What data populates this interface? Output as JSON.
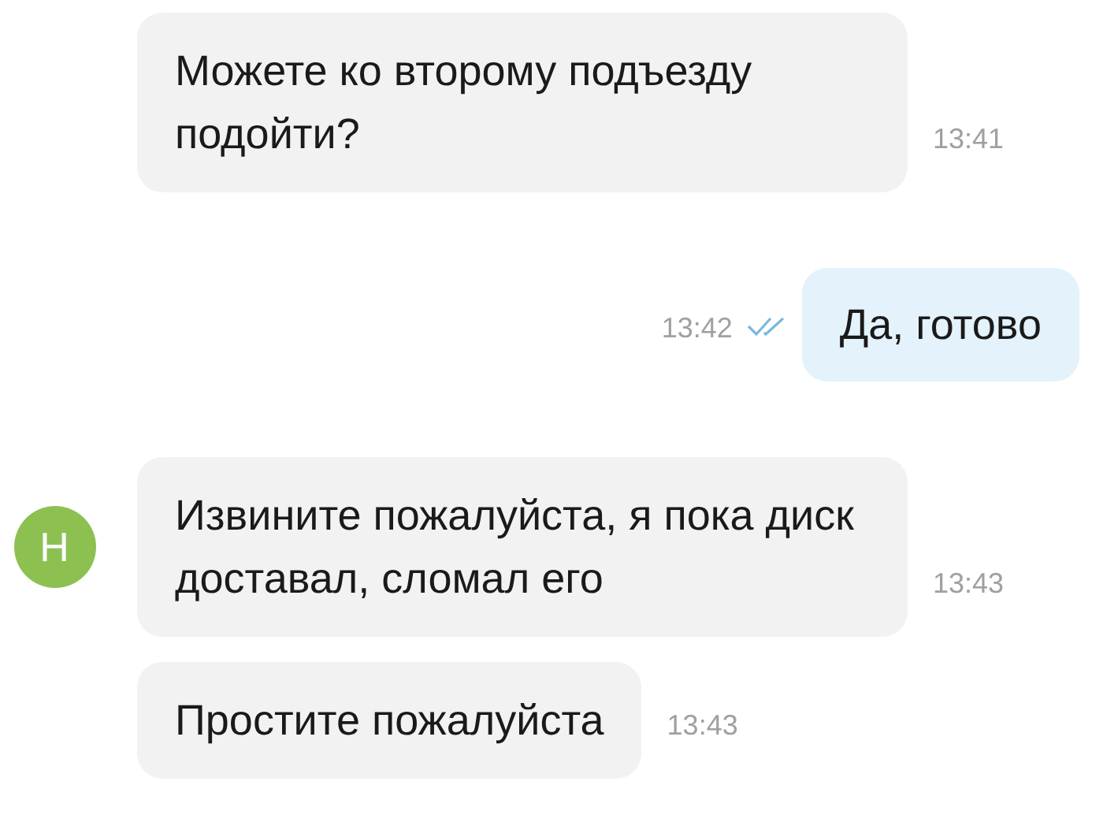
{
  "messages": [
    {
      "kind": "incoming",
      "text": "Можете ко второму подъезду подойти?",
      "time": "13:41"
    },
    {
      "kind": "outgoing",
      "text": "Да, готово",
      "time": "13:42",
      "read": true
    },
    {
      "kind": "incoming",
      "text": "Извините пожалуйста, я пока диск доставал, сломал его",
      "time": "13:43",
      "avatar": {
        "letter": "Н",
        "color": "#8cc152"
      }
    },
    {
      "kind": "incoming",
      "text": "Простите пожалуйста",
      "time": "13:43"
    }
  ]
}
